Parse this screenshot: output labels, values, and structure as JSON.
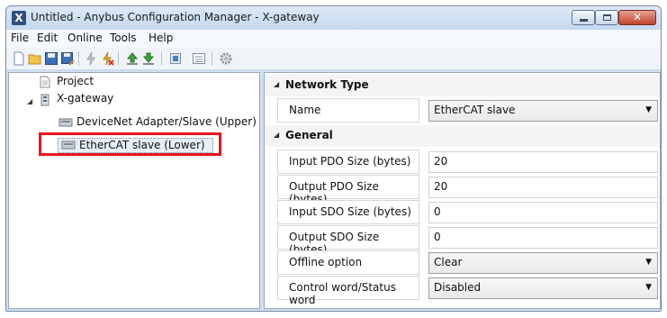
{
  "window": {
    "title": "Untitled - Anybus Configuration Manager - X-gateway",
    "app_icon_letter": "X",
    "close_glyph": "✕"
  },
  "menu": [
    "File",
    "Edit",
    "Online",
    "Tools",
    "Help"
  ],
  "toolbar_icons": [
    "new-document-icon",
    "open-folder-icon",
    "save-icon",
    "save-as-icon",
    "connect-icon",
    "disconnect-icon",
    "upload-icon",
    "download-icon",
    "module-icon",
    "list-icon",
    "settings-gear-icon"
  ],
  "tree": {
    "project_label": "Project",
    "gateway_label": "X-gateway",
    "children": [
      {
        "label": "DeviceNet Adapter/Slave (Upper)"
      },
      {
        "label": "EtherCAT slave (Lower)"
      }
    ]
  },
  "properties": {
    "network_type": {
      "label": "Network Type",
      "rows": [
        {
          "name": "Name",
          "value": "EtherCAT slave",
          "dropdown": true
        }
      ]
    },
    "general": {
      "label": "General",
      "rows": [
        {
          "name": "Input PDO Size (bytes)",
          "value": "20",
          "dropdown": false
        },
        {
          "name": "Output PDO Size (bytes)",
          "value": "20",
          "dropdown": false
        },
        {
          "name": "Input SDO Size (bytes)",
          "value": "0",
          "dropdown": false
        },
        {
          "name": "Output SDO Size (bytes)",
          "value": "0",
          "dropdown": false
        },
        {
          "name": "Offline option",
          "value": "Clear",
          "dropdown": true
        },
        {
          "name": "Control word/Status word",
          "value": "Disabled",
          "dropdown": true
        }
      ]
    }
  },
  "colors": {
    "highlight": "#e8141c",
    "titlebar": "#c4d8ef",
    "close_button": "#c0452e"
  }
}
